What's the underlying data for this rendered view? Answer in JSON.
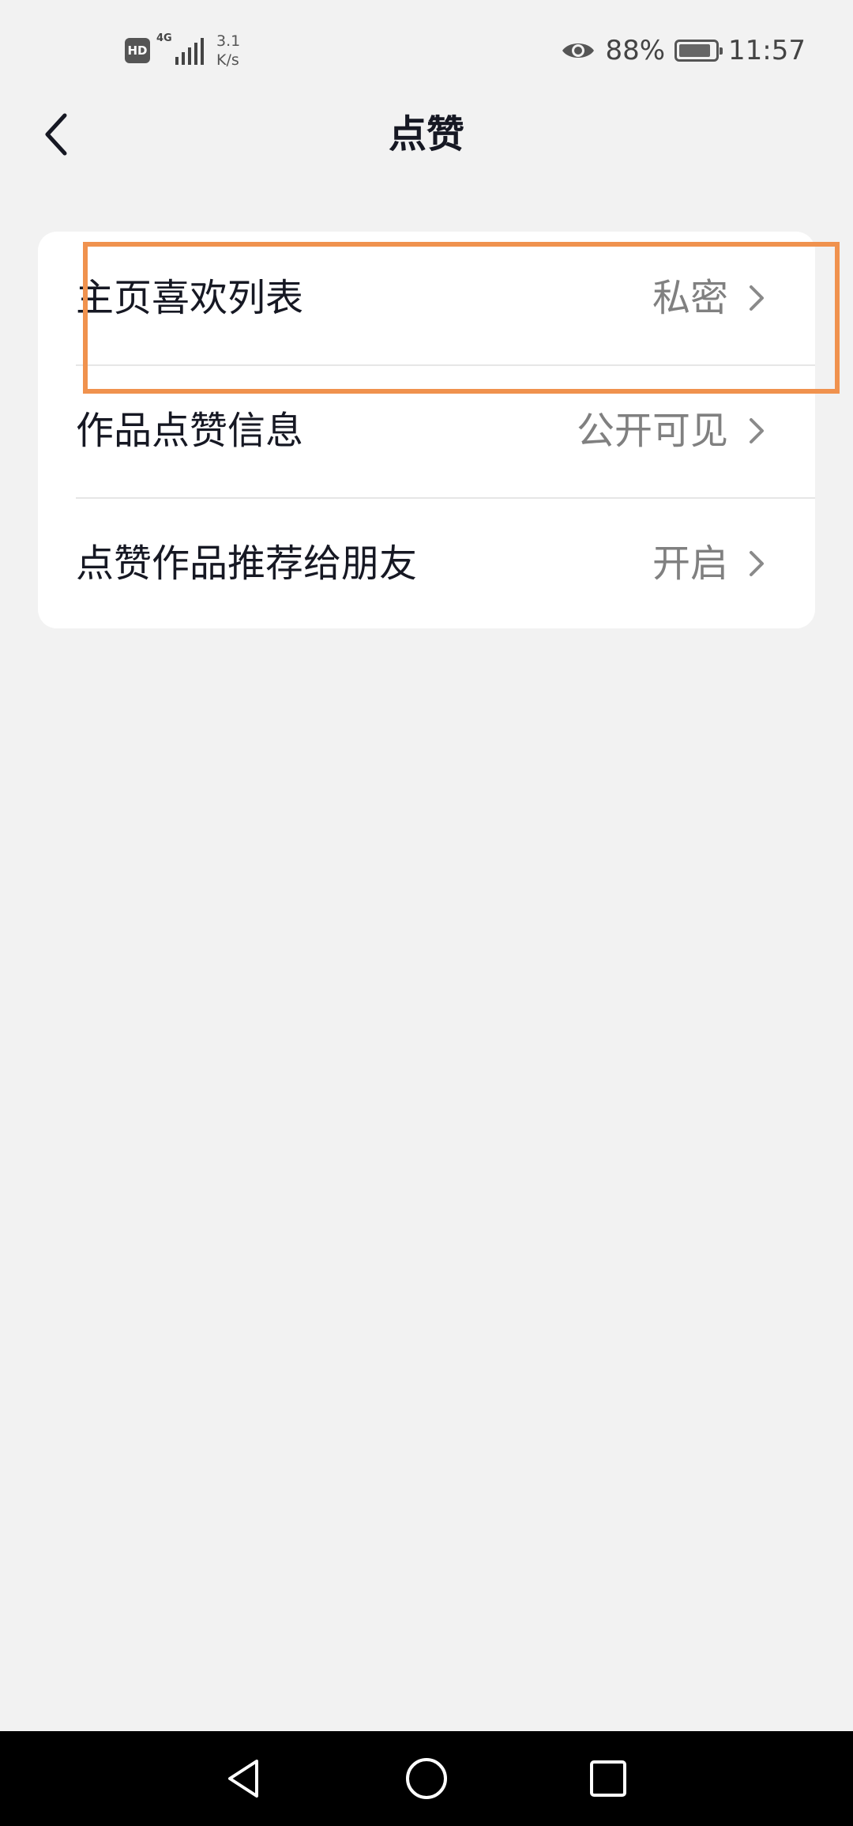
{
  "status_bar": {
    "hd": "HD",
    "network": "4G",
    "speed_value": "3.1",
    "speed_unit": "K/s",
    "battery_percent": "88%",
    "time": "11:57"
  },
  "header": {
    "title": "点赞"
  },
  "settings": [
    {
      "label": "主页喜欢列表",
      "value": "私密"
    },
    {
      "label": "作品点赞信息",
      "value": "公开可见"
    },
    {
      "label": "点赞作品推荐给朋友",
      "value": "开启"
    }
  ],
  "battery_level": 0.88,
  "colors": {
    "highlight": "#f0924e",
    "background": "#f2f2f2",
    "text_primary": "#161823",
    "text_secondary": "#808080"
  },
  "icons": {
    "back": "chevron-left-icon",
    "row_arrow": "chevron-right-icon",
    "nav_back": "triangle-back-icon",
    "nav_home": "circle-home-icon",
    "nav_recents": "square-recents-icon"
  }
}
